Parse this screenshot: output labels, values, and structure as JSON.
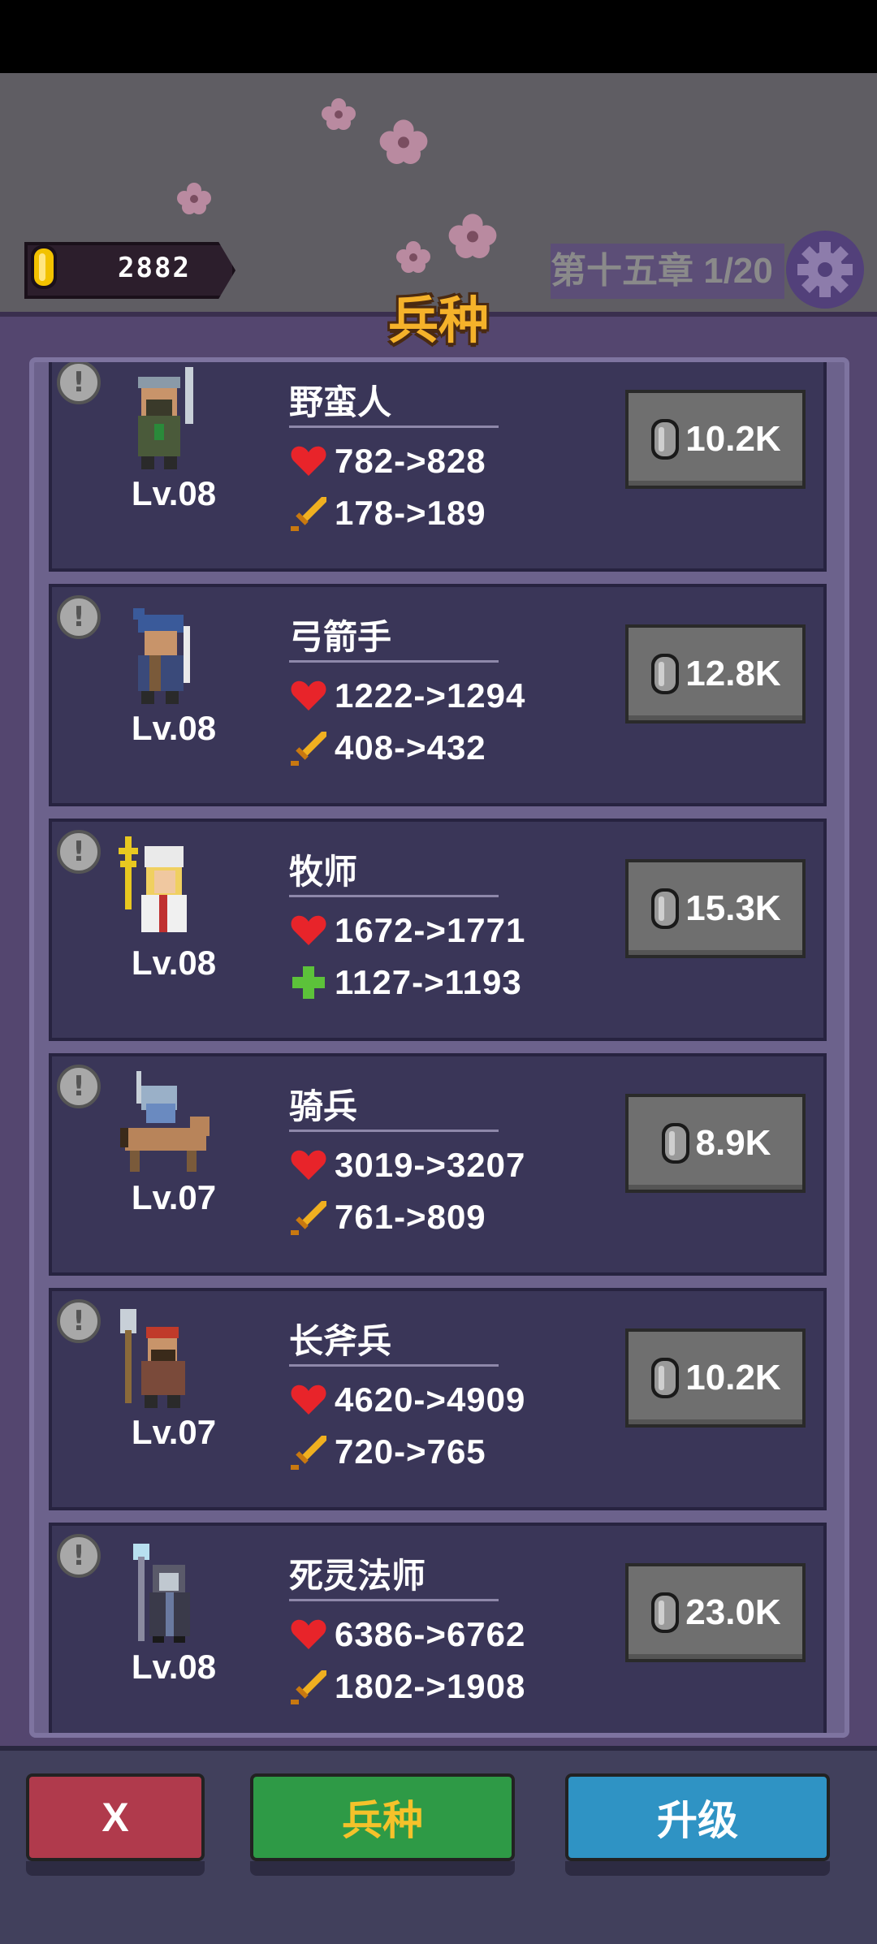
{
  "header": {
    "coins": "2882",
    "chapter": "第十五章 1/20",
    "panel_title": "兵种"
  },
  "units": [
    {
      "name": "野蛮人",
      "level": "Lv.08",
      "hp": "782->828",
      "stat2": "178->189",
      "stat2_icon": "sword-icon",
      "cost": "10.2K",
      "warn": "!"
    },
    {
      "name": "弓箭手",
      "level": "Lv.08",
      "hp": "1222->1294",
      "stat2": "408->432",
      "stat2_icon": "sword-icon",
      "cost": "12.8K",
      "warn": "!"
    },
    {
      "name": "牧师",
      "level": "Lv.08",
      "hp": "1672->1771",
      "stat2": "1127->1193",
      "stat2_icon": "heal-cross-icon",
      "cost": "15.3K",
      "warn": "!"
    },
    {
      "name": "骑兵",
      "level": "Lv.07",
      "hp": "3019->3207",
      "stat2": "761->809",
      "stat2_icon": "sword-icon",
      "cost": "8.9K",
      "warn": "!"
    },
    {
      "name": "长斧兵",
      "level": "Lv.07",
      "hp": "4620->4909",
      "stat2": "720->765",
      "stat2_icon": "sword-icon",
      "cost": "10.2K",
      "warn": "!"
    },
    {
      "name": "死灵法师",
      "level": "Lv.08",
      "hp": "6386->6762",
      "stat2": "1802->1908",
      "stat2_icon": "sword-icon",
      "cost": "23.0K",
      "warn": "!"
    }
  ],
  "bottom": {
    "close_label": "X",
    "units_label": "兵种",
    "upgrade_label": "升级"
  },
  "colors": {
    "accent_title": "#f5b22a",
    "close_button": "#b03a4c",
    "units_button": "#2e9a46",
    "upgrade_button": "#2f93c4",
    "hp_heart": "#e8242a",
    "sword": "#f0b020",
    "heal": "#5cc23a"
  }
}
